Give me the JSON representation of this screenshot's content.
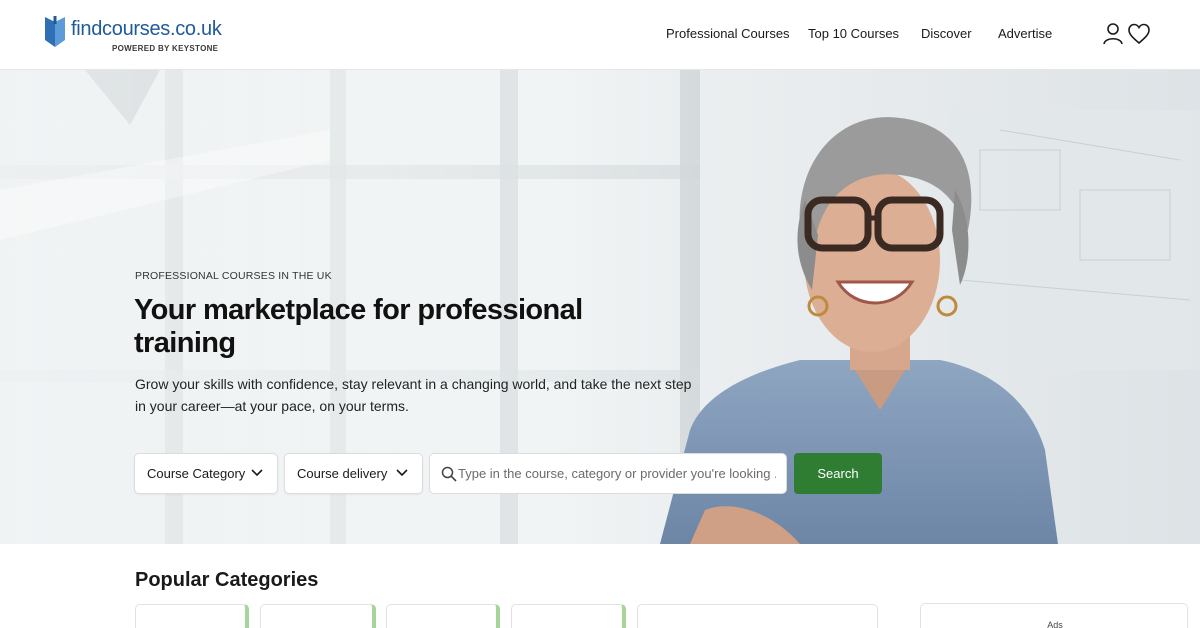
{
  "brand": {
    "name": "findcourses.co.uk",
    "tagline": "POWERED BY KEYSTONE",
    "color": "#1f5a99"
  },
  "nav": {
    "items": [
      {
        "label": "Professional Courses"
      },
      {
        "label": "Top 10 Courses"
      },
      {
        "label": "Discover"
      },
      {
        "label": "Advertise"
      }
    ],
    "icons": [
      "user-icon",
      "heart-icon"
    ]
  },
  "hero": {
    "eyebrow": "PROFESSIONAL COURSES IN THE UK",
    "title": "Your marketplace for professional training",
    "description": "Grow your skills with confidence, stay relevant in a changing world, and take the next step in your career—at your pace, on your terms.",
    "filters": {
      "category_label": "Course Category",
      "delivery_label": "Course delivery"
    },
    "search": {
      "placeholder": "Type in the course, category or provider you're looking ...",
      "button_label": "Search"
    }
  },
  "popular": {
    "title": "Popular Categories"
  },
  "ads": {
    "label": "Ads"
  },
  "colors": {
    "accent_green": "#2e7d32",
    "card_accent": "#a7d49b"
  }
}
